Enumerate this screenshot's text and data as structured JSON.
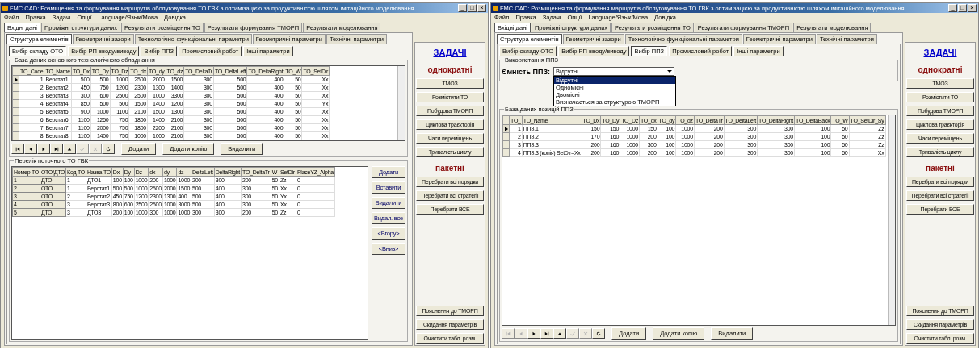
{
  "windows": [
    {
      "title": "FMC CAD: Розміщення та формування маршрутів обслуговування ТО ГВК з оптимізацією за продуктивністю шляхом імітаційного моделювання",
      "controls": [
        "_",
        "□",
        "×"
      ],
      "menu": [
        "Файл",
        "Правка",
        "Задачі",
        "Опції",
        "Language/Язык/Мова",
        "Довідка"
      ],
      "tabs": [
        {
          "label": "Вхідні дані",
          "selected": true
        },
        {
          "label": "Проміжні структури даних",
          "selected": false
        },
        {
          "label": "Результати розміщення ТО",
          "selected": false
        },
        {
          "label": "Результати формування ТМОРП",
          "selected": false
        },
        {
          "label": "Результати моделювання",
          "selected": false
        }
      ],
      "subtabs": [
        {
          "label": "Структура елементів",
          "selected": true
        },
        {
          "label": "Геометричні зазори",
          "selected": false
        },
        {
          "label": "Технологічно-функціональні параметри",
          "selected": false
        },
        {
          "label": "Геометричні параметри",
          "selected": false
        },
        {
          "label": "Технічні параметри",
          "selected": false
        }
      ],
      "pages": [
        {
          "label": "Вибір складу ОТО",
          "selected": true
        },
        {
          "label": "Вибір РП вводу/виводу",
          "selected": false
        },
        {
          "label": "Вибір ППЗ",
          "selected": false
        },
        {
          "label": "Промисловий робот",
          "selected": false
        },
        {
          "label": "Інші параметри",
          "selected": false
        }
      ],
      "groups": [
        {
          "kind": "grid",
          "legend": "База даних основного технологічного обладнання",
          "columns": [
            "TO_Code",
            "TO_Name",
            "TO_Dx",
            "TO_Dy",
            "TO_Dz",
            "TO_dx",
            "TO_dy",
            "TO_dz",
            "TO_DeltaTr",
            "TO_DeltaLeft",
            "TO_DeltaRight",
            "TO_W",
            "TO_SetDir"
          ],
          "rows": [
            {
              "current": true,
              "cells": [
                "1",
                "Верстат1",
                "500",
                "500",
                "1000",
                "2500",
                "2000",
                "1500",
                "300",
                "500",
                "400",
                "50",
                "Xx"
              ]
            },
            {
              "current": false,
              "cells": [
                "2",
                "Верстат2",
                "450",
                "750",
                "1200",
                "2300",
                "1300",
                "1400",
                "300",
                "500",
                "400",
                "50",
                "Xx"
              ]
            },
            {
              "current": false,
              "cells": [
                "3",
                "Верстат3",
                "300",
                "600",
                "2500",
                "2500",
                "1000",
                "3300",
                "300",
                "500",
                "400",
                "50",
                "Xx"
              ]
            },
            {
              "current": false,
              "cells": [
                "4",
                "Верстат4",
                "850",
                "500",
                "500",
                "1500",
                "1400",
                "1200",
                "300",
                "500",
                "400",
                "50",
                "Yx"
              ]
            },
            {
              "current": false,
              "cells": [
                "5",
                "Верстат5",
                "900",
                "1000",
                "1100",
                "2100",
                "1500",
                "1300",
                "300",
                "500",
                "400",
                "50",
                "Xx"
              ]
            },
            {
              "current": false,
              "cells": [
                "6",
                "Верстат6",
                "1100",
                "1250",
                "750",
                "1800",
                "1400",
                "2100",
                "300",
                "500",
                "400",
                "50",
                "Xx"
              ]
            },
            {
              "current": false,
              "cells": [
                "7",
                "Верстат7",
                "1100",
                "2000",
                "750",
                "1800",
                "2200",
                "2100",
                "300",
                "500",
                "400",
                "50",
                "Xx"
              ]
            },
            {
              "current": false,
              "cells": [
                "8",
                "Верстат8",
                "1100",
                "1400",
                "750",
                "1000",
                "1000",
                "2100",
                "300",
                "500",
                "400",
                "50",
                "Xx"
              ]
            }
          ],
          "navigator": [
            {
              "kind": "first",
              "disabled": false
            },
            {
              "kind": "prior",
              "disabled": false
            },
            {
              "kind": "next",
              "disabled": false
            },
            {
              "kind": "last",
              "disabled": false
            },
            {
              "kind": "insert",
              "disabled": false
            },
            {
              "kind": "post",
              "disabled": true
            },
            {
              "kind": "cancel",
              "disabled": true
            },
            {
              "kind": "refresh",
              "disabled": false
            }
          ],
          "buttons": [
            "Додати",
            "Додати копію",
            "Видалити"
          ]
        },
        {
          "kind": "list",
          "legend": "Перелік поточного ТО ГВК",
          "columns": [
            "Номер ТО",
            "ОТО/ДТО",
            "Код ТО",
            "Назва ТО",
            "Dx",
            "Dy",
            "Dz",
            "dx",
            "dy",
            "dz",
            "DeltaLeft",
            "DeltaRight",
            "TO_DeltaTr",
            "W",
            "SetDir",
            "PlaceYZ_Alpha"
          ],
          "rows": [
            [
              "1",
              "ДТО",
              "1",
              "ДТО1",
              "100",
              "100",
              "1000",
              "200",
              "1000",
              "1000",
              "200",
              "300",
              "200",
              "50",
              "Zz",
              "0"
            ],
            [
              "2",
              "ОТО",
              "1",
              "Верстат1",
              "500",
              "500",
              "1000",
              "2500",
              "2000",
              "1500",
              "500",
              "400",
              "300",
              "50",
              "Xx",
              "0"
            ],
            [
              "3",
              "ОТО",
              "2",
              "Верстат2",
              "450",
              "750",
              "1200",
              "2300",
              "1300",
              "400",
              "500",
              "400",
              "300",
              "50",
              "Yx",
              "0"
            ],
            [
              "4",
              "ОТО",
              "3",
              "Верстат3",
              "800",
              "600",
              "2500",
              "2500",
              "1000",
              "3000",
              "500",
              "400",
              "300",
              "50",
              "Xx",
              "0"
            ],
            [
              "5",
              "ДТО",
              "3",
              "ДТО3",
              "200",
              "100",
              "1000",
              "300",
              "1000",
              "1000",
              "300",
              "300",
              "200",
              "50",
              "Zz",
              "0"
            ]
          ],
          "buttons": [
            "Додати",
            "Вставити",
            "Видалити",
            "Видал. все",
            "<Вгору>",
            "<Вниз>"
          ]
        }
      ],
      "tasks": {
        "title": "ЗАДАЧІ",
        "single_label": "однократні",
        "single": [
          "ТМОЗ",
          "Розмістити ТО",
          "Побудова ТМОРП",
          "Циклова траєкторія",
          "Часи переміщень",
          "Тривалість циклу"
        ],
        "batch_label": "пакетні",
        "batch": [
          "Перебрати всі порядки",
          "Перебрати всі стратегії",
          "Перебрати ВСЕ"
        ],
        "bottom": [
          "Пояснення до ТМОРП",
          "Скидання параметрів",
          "Очистити табл. розм."
        ]
      }
    },
    {
      "title": "FMC CAD: Розміщення та формування маршрутів обслуговування ТО ГВК з оптимізацією за продуктивністю шляхом імітаційного моделювання",
      "controls": [
        "_",
        "□",
        "×"
      ],
      "menu": [
        "Файл",
        "Правка",
        "Задачі",
        "Опції",
        "Language/Язык/Мова",
        "Довідка"
      ],
      "tabs": [
        {
          "label": "Вхідні дані",
          "selected": true
        },
        {
          "label": "Проміжні структури даних",
          "selected": false
        },
        {
          "label": "Результати розміщення ТО",
          "selected": false
        },
        {
          "label": "Результати формування ТМОРП",
          "selected": false
        },
        {
          "label": "Результати моделювання",
          "selected": false
        }
      ],
      "subtabs": [
        {
          "label": "Структура елементів",
          "selected": true
        },
        {
          "label": "Геометричні зазори",
          "selected": false
        },
        {
          "label": "Технологічно-функціональні параметри",
          "selected": false
        },
        {
          "label": "Геометричні параметри",
          "selected": false
        },
        {
          "label": "Технічні параметри",
          "selected": false
        }
      ],
      "pages": [
        {
          "label": "Вибір складу ОТО",
          "selected": false
        },
        {
          "label": "Вибір РП вводу/виводу",
          "selected": false
        },
        {
          "label": "Вибір ППЗ",
          "selected": true
        },
        {
          "label": "Промисловий робот",
          "selected": false
        },
        {
          "label": "Інші параметри",
          "selected": false
        }
      ],
      "groups": [
        {
          "kind": "combo",
          "legend": "Використання ППЗ",
          "label": "Ємність ППЗ:",
          "value": "Відсутні",
          "expanded": true,
          "options": [
            {
              "label": "Відсутні",
              "selected": true
            },
            {
              "label": "Одномісні",
              "selected": false
            },
            {
              "label": "Двомісні",
              "selected": false
            },
            {
              "label": "Визначається за структурою ТМОРП",
              "selected": false
            }
          ]
        },
        {
          "kind": "grid",
          "legend": "База даних позицій ППЗ",
          "columns": [
            "TO_",
            "TO_Name",
            "TO_Dx",
            "TO_Dy",
            "TO_Dz",
            "TO_dx",
            "TO_dy",
            "TO_dz",
            "TO_DeltaTr",
            "TO_DeltaLeft",
            "TO_DeltaRight",
            "TO_DeltaBack",
            "TO_W",
            "TO_SetDir_Sy"
          ],
          "rows": [
            {
              "current": true,
              "cells": [
                "1",
                "ППЗ.1",
                "150",
                "150",
                "1000",
                "150",
                "100",
                "1000",
                "200",
                "300",
                "300",
                "100",
                "50",
                "Zz"
              ]
            },
            {
              "current": false,
              "cells": [
                "2",
                "ППЗ.2",
                "170",
                "160",
                "1000",
                "200",
                "100",
                "1000",
                "200",
                "300",
                "300",
                "100",
                "50",
                "Zz"
              ]
            },
            {
              "current": false,
              "cells": [
                "3",
                "ППЗ.3",
                "200",
                "160",
                "1000",
                "300",
                "100",
                "1000",
                "200",
                "300",
                "300",
                "100",
                "50",
                "Zz"
              ]
            },
            {
              "current": false,
              "cells": [
                "4",
                "ППЗ.3 (копія) SetDir=Xx",
                "200",
                "160",
                "1000",
                "200",
                "100",
                "1000",
                "200",
                "300",
                "300",
                "100",
                "50",
                "Xx"
              ]
            }
          ],
          "navigator": [
            {
              "kind": "first",
              "disabled": true
            },
            {
              "kind": "prior",
              "disabled": true
            },
            {
              "kind": "next",
              "disabled": false
            },
            {
              "kind": "last",
              "disabled": false
            },
            {
              "kind": "insert",
              "disabled": false
            },
            {
              "kind": "post",
              "disabled": true
            },
            {
              "kind": "cancel",
              "disabled": true
            },
            {
              "kind": "refresh",
              "disabled": false
            }
          ],
          "buttons": [
            "Додати",
            "Додати копію",
            "Видалити"
          ]
        }
      ],
      "tasks": {
        "title": "ЗАДАЧІ",
        "single_label": "однократні",
        "single": [
          "ТМОЗ",
          "Розмістити ТО",
          "Побудова ТМОРП",
          "Циклова траєкторія",
          "Часи переміщень",
          "Тривалість циклу"
        ],
        "batch_label": "пакетні",
        "batch": [
          "Перебрати всі порядки",
          "Перебрати всі стратегії",
          "Перебрати ВСЕ"
        ],
        "bottom": [
          "Пояснення до ТМОРП",
          "Скидання параметрів",
          "Очистити табл. розм."
        ]
      }
    }
  ]
}
